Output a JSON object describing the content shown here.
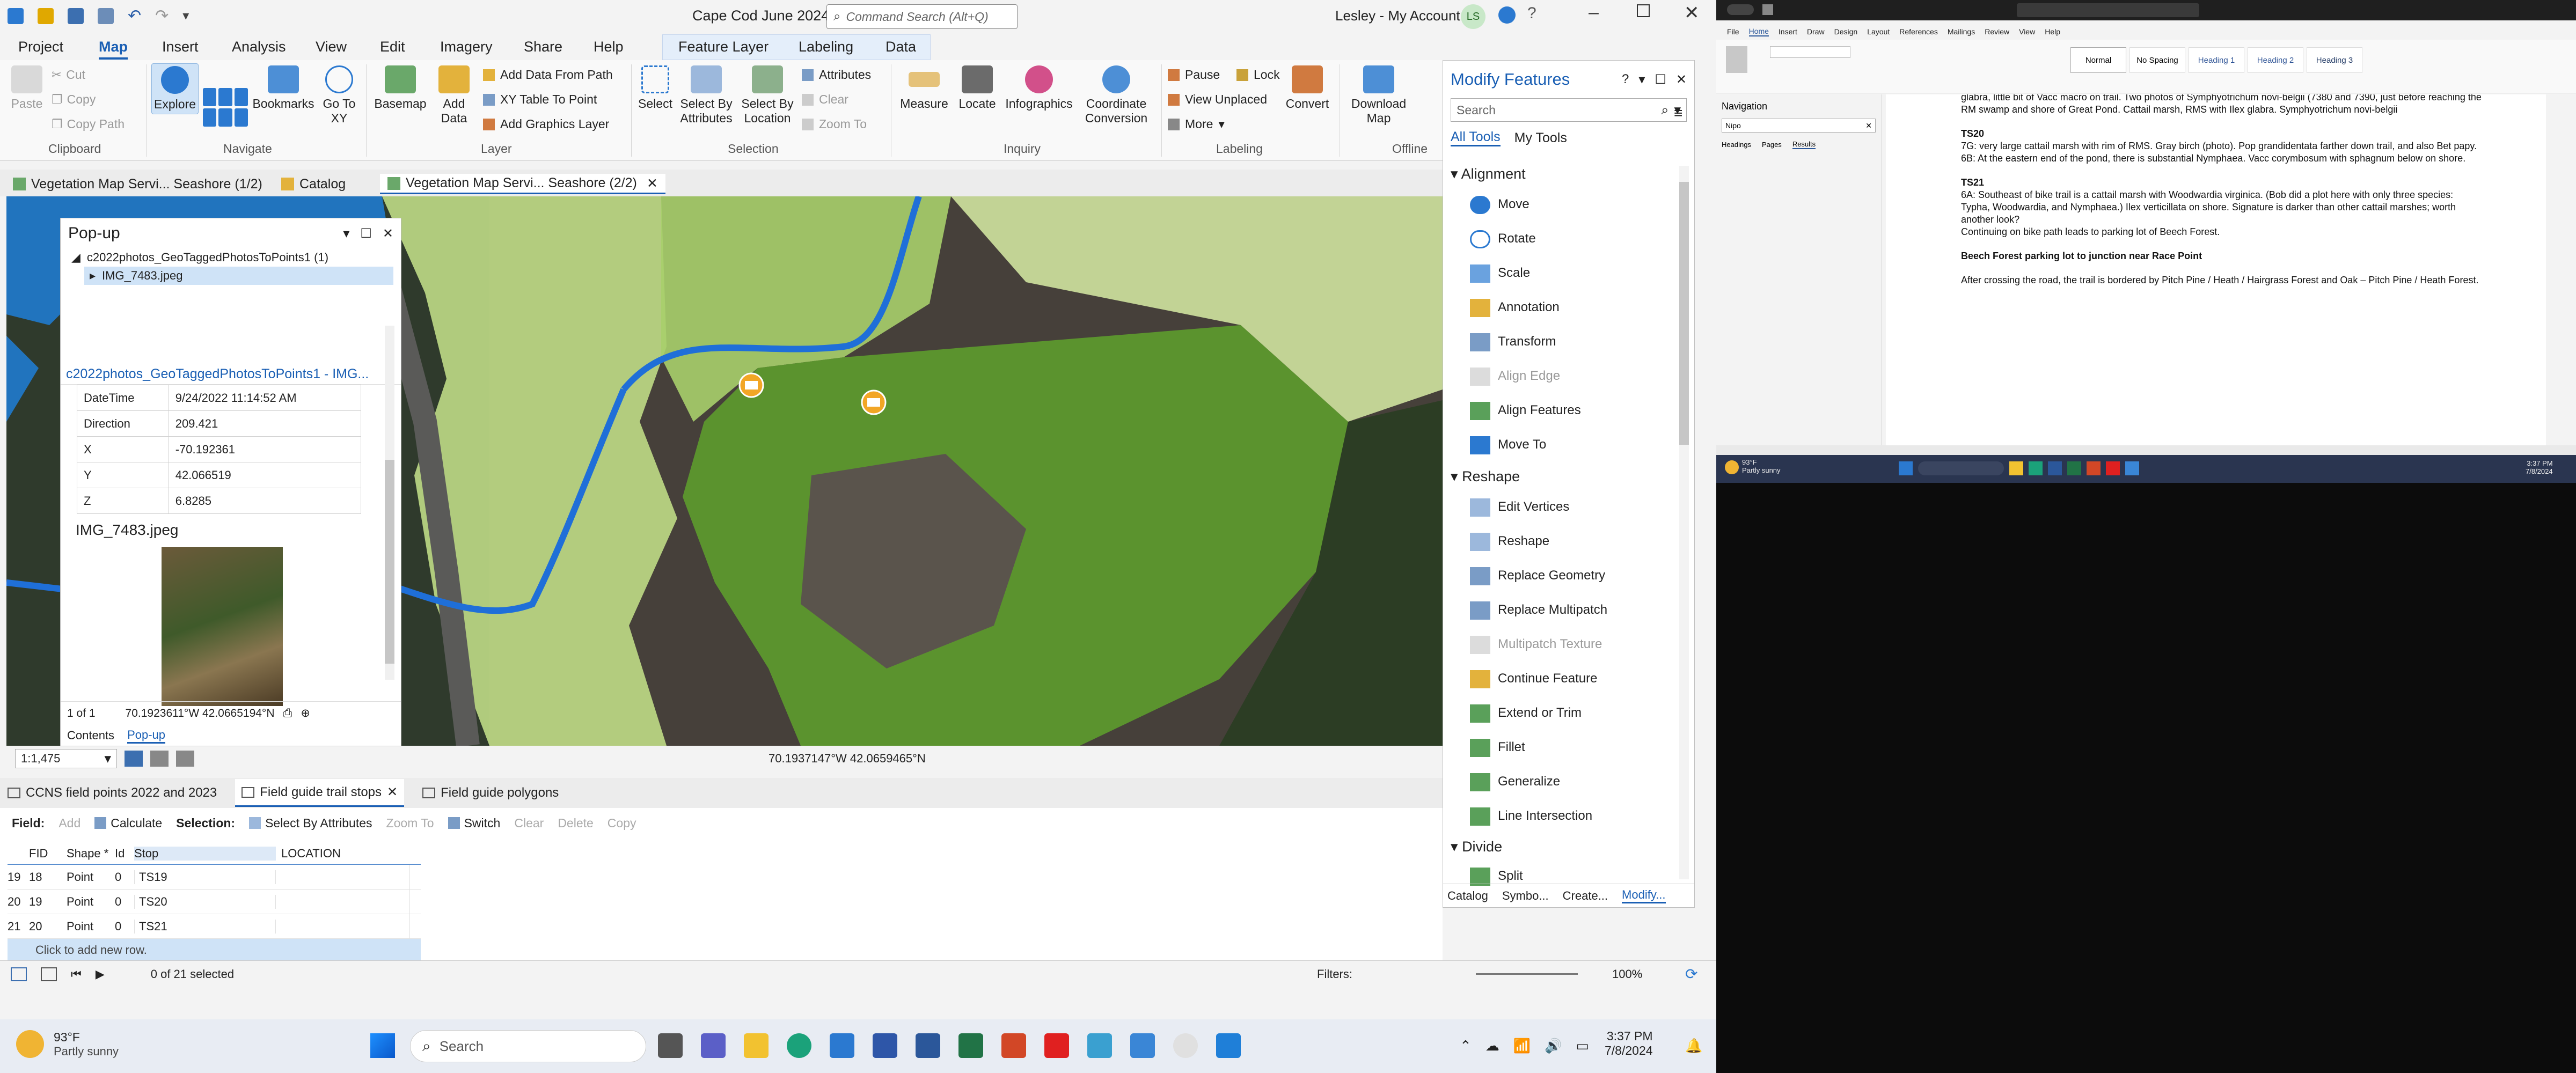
{
  "title": {
    "doc": "Cape Cod June 2024",
    "search_placeholder": "Command Search (Alt+Q)",
    "user": "Lesley - My Account",
    "initials": "LS"
  },
  "ribbon_tabs": [
    "Project",
    "Map",
    "Insert",
    "Analysis",
    "View",
    "Edit",
    "Imagery",
    "Share",
    "Help"
  ],
  "context_tabs": [
    "Feature Layer",
    "Labeling",
    "Data"
  ],
  "ribbon": {
    "clipboard": {
      "paste": "Paste",
      "cut": "Cut",
      "copy": "Copy",
      "copy_path": "Copy Path",
      "group": "Clipboard"
    },
    "navigate": {
      "explore": "Explore",
      "bookmarks": "Bookmarks",
      "go_to_xy": "Go To XY",
      "group": "Navigate"
    },
    "layer": {
      "basemap": "Basemap",
      "add_data": "Add Data",
      "add_data_from_path": "Add Data From Path",
      "xy_table": "XY Table To Point",
      "add_graphics": "Add Graphics Layer",
      "group": "Layer"
    },
    "selection": {
      "select": "Select",
      "select_by_attr": "Select By Attributes",
      "select_by_loc": "Select By Location",
      "attributes": "Attributes",
      "clear": "Clear",
      "zoom_to": "Zoom To",
      "group": "Selection"
    },
    "inquiry": {
      "measure": "Measure",
      "locate": "Locate",
      "infographics": "Infographics",
      "coord": "Coordinate Conversion",
      "group": "Inquiry"
    },
    "labeling": {
      "pause": "Pause",
      "lock": "Lock",
      "view_unplaced": "View Unplaced",
      "more": "More",
      "convert": "Convert",
      "group": "Labeling"
    },
    "offline": {
      "download": "Download Map",
      "group": "Offline"
    }
  },
  "doc_tabs": [
    "Vegetation Map Servi... Seashore (1/2)",
    "Catalog",
    "Vegetation Map Servi... Seashore (2/2)"
  ],
  "popup": {
    "title": "Pop-up",
    "layer": "c2022photos_GeoTaggedPhotosToPoints1 (1)",
    "feature": "IMG_7483.jpeg",
    "header": "c2022photos_GeoTaggedPhotosToPoints1 - IMG...",
    "fields": [
      {
        "k": "DateTime",
        "v": "9/24/2022 11:14:52 AM"
      },
      {
        "k": "Direction",
        "v": "209.421"
      },
      {
        "k": "X",
        "v": "-70.192361"
      },
      {
        "k": "Y",
        "v": "42.066519"
      },
      {
        "k": "Z",
        "v": "6.8285"
      }
    ],
    "image_title": "IMG_7483.jpeg",
    "nav": "1 of 1",
    "coords": "70.1923611°W 42.0665194°N",
    "tabs": [
      "Contents",
      "Pop-up"
    ]
  },
  "map_status": {
    "scale": "1:1,475",
    "coords": "70.1937147°W 42.0659465°N"
  },
  "modify": {
    "title": "Modify Features",
    "search_placeholder": "Search",
    "tabs": [
      "All Tools",
      "My Tools"
    ],
    "sections": {
      "alignment": "Alignment",
      "reshape": "Reshape",
      "divide": "Divide"
    },
    "alignment": [
      {
        "t": "Move",
        "d": false
      },
      {
        "t": "Rotate",
        "d": false
      },
      {
        "t": "Scale",
        "d": false
      },
      {
        "t": "Annotation",
        "d": false
      },
      {
        "t": "Transform",
        "d": false
      },
      {
        "t": "Align Edge",
        "d": true
      },
      {
        "t": "Align Features",
        "d": false
      },
      {
        "t": "Move To",
        "d": false
      }
    ],
    "reshape": [
      {
        "t": "Edit Vertices",
        "d": false
      },
      {
        "t": "Reshape",
        "d": false
      },
      {
        "t": "Replace Geometry",
        "d": false
      },
      {
        "t": "Replace Multipatch",
        "d": false
      },
      {
        "t": "Multipatch Texture",
        "d": true
      },
      {
        "t": "Continue Feature",
        "d": false
      },
      {
        "t": "Extend or Trim",
        "d": false
      },
      {
        "t": "Fillet",
        "d": false
      },
      {
        "t": "Generalize",
        "d": false
      },
      {
        "t": "Line Intersection",
        "d": false
      }
    ],
    "divide": [
      {
        "t": "Split",
        "d": false
      }
    ],
    "bottom_tabs": [
      "Catalog",
      "Symbo...",
      "Create...",
      "Modify..."
    ]
  },
  "table_tabs": [
    "CCNS field points 2022 and 2023",
    "Field guide trail stops",
    "Field guide polygons"
  ],
  "table_toolbar": {
    "field": "Field:",
    "add": "Add",
    "calculate": "Calculate",
    "selection": "Selection:",
    "select_by_attr": "Select By Attributes",
    "zoom_to": "Zoom To",
    "switch": "Switch",
    "clear": "Clear",
    "delete": "Delete",
    "copy": "Copy"
  },
  "table": {
    "columns": [
      "FID",
      "Shape *",
      "Id",
      "Stop",
      "LOCATION"
    ],
    "rows": [
      {
        "n": "19",
        "fid": "18",
        "shape": "Point",
        "id": "0",
        "stop": "TS19"
      },
      {
        "n": "20",
        "fid": "19",
        "shape": "Point",
        "id": "0",
        "stop": "TS20"
      },
      {
        "n": "21",
        "fid": "20",
        "shape": "Point",
        "id": "0",
        "stop": "TS21"
      }
    ],
    "add_row": "Click to add new row.",
    "selected": "0 of 21 selected",
    "filters": "Filters:",
    "zoom": "100%"
  },
  "taskbar": {
    "temp": "93°F",
    "weather": "Partly sunny",
    "search": "Search",
    "time": "3:37 PM",
    "date": "7/8/2024"
  },
  "word": {
    "nav_title": "Navigation",
    "nav_search": "Nipo",
    "nav_tabs": [
      "Headings",
      "Pages",
      "Results"
    ],
    "body": [
      {
        "t": "glabra, little bit of Vacc macro on trail. Two photos of Symphyotrichum novi-belgii (7380 and 7390, just before reaching the RM swamp and shore of Great Pond. Cattail marsh, RMS with Ilex glabra. Symphyotrichum novi-belgii",
        "b": false
      },
      {
        "t": "TS20",
        "b": true
      },
      {
        "t": "7G: very large cattail marsh with rim of RMS. Gray birch (photo). Pop grandidentata farther down trail, and also Bet papy.",
        "b": false
      },
      {
        "t": "6B: At the eastern end of the pond, there is substantial Nymphaea. Vacc corymbosum with sphagnum below on shore.",
        "b": false
      },
      {
        "t": "TS21",
        "b": true
      },
      {
        "t": "6A: Southeast of bike trail is a cattail marsh with Woodwardia virginica. (Bob did a plot here with only three species: Typha, Woodwardia, and Nymphaea.) Ilex verticillata on shore. Signature is darker than other cattail marshes; worth another look?",
        "b": false
      },
      {
        "t": "Continuing on bike path leads to parking lot of Beech Forest.",
        "b": false
      },
      {
        "t": "Beech Forest parking lot to junction near Race Point",
        "b": true
      },
      {
        "t": "After crossing the road, the trail is bordered by Pitch Pine / Heath / Hairgrass Forest and Oak – Pitch Pine / Heath Forest.",
        "b": false
      }
    ],
    "styles": [
      "Normal",
      "No Spacing",
      "Heading 1",
      "Heading 2",
      "Heading 3"
    ],
    "tabs": [
      "File",
      "Home",
      "Insert",
      "Draw",
      "Design",
      "Layout",
      "References",
      "Mailings",
      "Review",
      "View",
      "Help"
    ],
    "temp": "93°F",
    "weather": "Partly sunny",
    "time": "3:37 PM",
    "date": "7/8/2024"
  }
}
